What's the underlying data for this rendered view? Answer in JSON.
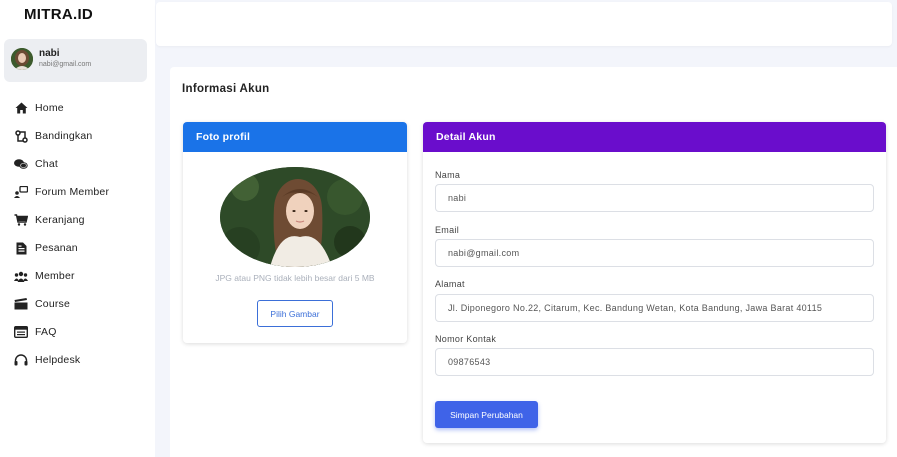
{
  "brand": "MITRA.ID",
  "user": {
    "name": "nabi",
    "email": "nabi@gmail.com"
  },
  "nav": [
    {
      "label": "Home",
      "icon": "home-icon"
    },
    {
      "label": "Bandingkan",
      "icon": "compare-icon"
    },
    {
      "label": "Chat",
      "icon": "chat-icon"
    },
    {
      "label": "Forum Member",
      "icon": "forum-icon"
    },
    {
      "label": "Keranjang",
      "icon": "cart-icon"
    },
    {
      "label": "Pesanan",
      "icon": "order-icon"
    },
    {
      "label": "Member",
      "icon": "members-icon"
    },
    {
      "label": "Course",
      "icon": "course-icon"
    },
    {
      "label": "FAQ",
      "icon": "faq-icon"
    },
    {
      "label": "Helpdesk",
      "icon": "headset-icon"
    }
  ],
  "page": {
    "title": "Informasi Akun"
  },
  "photo_panel": {
    "title": "Foto profil",
    "hint": "JPG atau PNG tidak lebih besar dari 5 MB",
    "button": "Pilih Gambar"
  },
  "detail_panel": {
    "title": "Detail Akun",
    "fields": [
      {
        "label": "Nama",
        "value": "nabi"
      },
      {
        "label": "Email",
        "value": "nabi@gmail.com"
      },
      {
        "label": "Alamat",
        "value": "Jl. Diponegoro No.22, Citarum, Kec. Bandung Wetan, Kota Bandung, Jawa Barat 40115"
      },
      {
        "label": "Nomor Kontak",
        "value": "09876543"
      }
    ],
    "save_button": "Simpan Perubahan"
  },
  "colors": {
    "photo_header": "#1a73e8",
    "detail_header": "#6a0dcc",
    "primary_button": "#3f63e8"
  }
}
